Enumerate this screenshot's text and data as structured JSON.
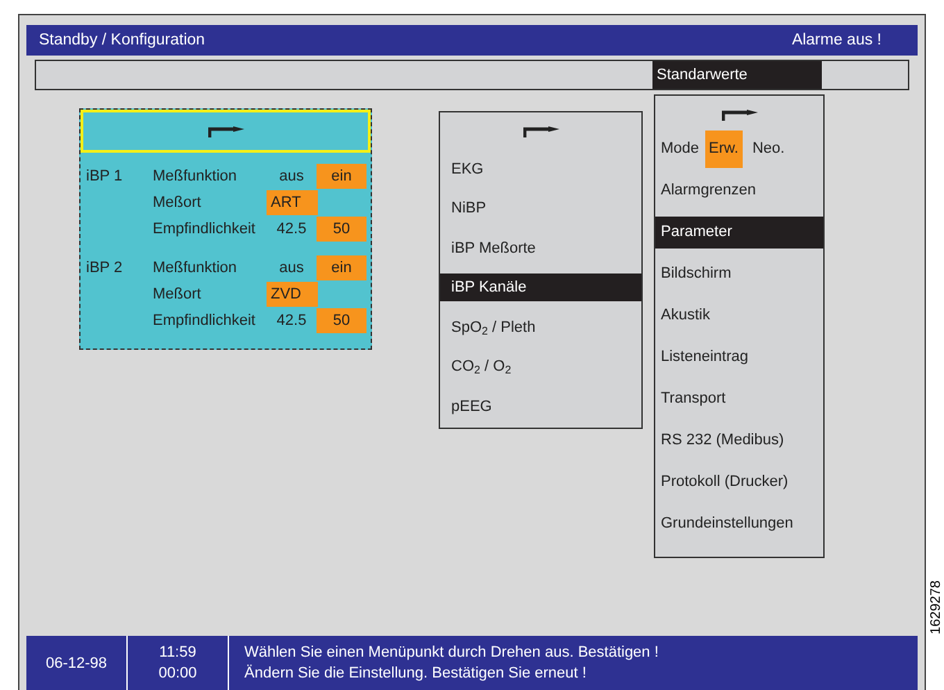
{
  "title_bar": {
    "title": "Standby / Konfiguration",
    "alarm": "Alarme aus !"
  },
  "menu_strip": {
    "items": [
      {
        "label": "Standarwerte",
        "selected": true
      }
    ]
  },
  "channel_panel": {
    "channels": [
      {
        "name": "iBP 1",
        "rows": [
          {
            "label": "Meßfunktion",
            "options": [
              {
                "text": "aus",
                "selected": false
              },
              {
                "text": "ein",
                "selected": true
              }
            ]
          },
          {
            "label": "Meßort",
            "options": [
              {
                "text": "ART",
                "selected": true
              }
            ]
          },
          {
            "label": "Empfindlichkeit",
            "options": [
              {
                "text": "42.5",
                "selected": false
              },
              {
                "text": "50",
                "selected": true
              }
            ]
          }
        ]
      },
      {
        "name": "iBP 2",
        "rows": [
          {
            "label": "Meßfunktion",
            "options": [
              {
                "text": "aus",
                "selected": false
              },
              {
                "text": "ein",
                "selected": true
              }
            ]
          },
          {
            "label": "Meßort",
            "options": [
              {
                "text": "ZVD",
                "selected": true
              }
            ]
          },
          {
            "label": "Empfindlichkeit",
            "options": [
              {
                "text": "42.5",
                "selected": false
              },
              {
                "text": "50",
                "selected": true
              }
            ]
          }
        ]
      }
    ]
  },
  "parameter_menu": {
    "items": [
      {
        "label": "EKG",
        "selected": false
      },
      {
        "label": "NiBP",
        "selected": false
      },
      {
        "label": "iBP Meßorte",
        "selected": false
      },
      {
        "label": "iBP Kanäle",
        "selected": true
      },
      {
        "label": "SpO$_{2}$ / Pleth",
        "selected": false
      },
      {
        "label": "CO$_{2}$ / O$_{2}$",
        "selected": false
      },
      {
        "label": "pEEG",
        "selected": false
      }
    ]
  },
  "standard_menu": {
    "items": [
      {
        "kind": "mode",
        "label": "Mode",
        "options": [
          {
            "text": "Erw.",
            "selected": true
          },
          {
            "text": "Neo.",
            "selected": false
          }
        ],
        "selected": false
      },
      {
        "kind": "item",
        "label": "Alarmgrenzen",
        "selected": false
      },
      {
        "kind": "item",
        "label": "Parameter",
        "selected": true
      },
      {
        "kind": "item",
        "label": "Bildschirm",
        "selected": false
      },
      {
        "kind": "item",
        "label": "Akustik",
        "selected": false
      },
      {
        "kind": "item",
        "label": "Listeneintrag",
        "selected": false
      },
      {
        "kind": "item",
        "label": "Transport",
        "selected": false
      },
      {
        "kind": "item",
        "label": "RS 232 (Medibus)",
        "selected": false
      },
      {
        "kind": "item",
        "label": "Protokoll (Drucker)",
        "selected": false
      },
      {
        "kind": "item",
        "label": "Grundeinstellungen",
        "selected": false
      }
    ]
  },
  "status_bar": {
    "date": "06-12-98",
    "times": [
      "11:59",
      "00:00"
    ],
    "messages": [
      "Wählen Sie einen Menüpunkt durch Drehen aus. Bestätigen !",
      "Ändern Sie die Einstellung. Bestätigen Sie erneut !"
    ]
  },
  "figure_number": "1629278"
}
